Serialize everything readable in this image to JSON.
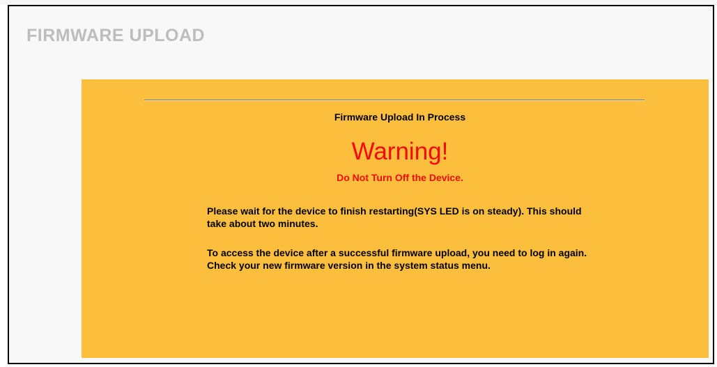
{
  "page": {
    "title": "FIRMWARE UPLOAD"
  },
  "panel": {
    "process_title": "Firmware Upload In Process",
    "warning_title": "Warning!",
    "warning_subtitle": "Do Not Turn Off the Device.",
    "message_restart": "Please wait for the device to finish restarting(SYS LED is on steady). This should take about two minutes.",
    "message_login": "To access the device after a successful firmware upload, you need to log in again. Check your new firmware version in the system status menu."
  },
  "colors": {
    "panel_background": "#fcbe3d",
    "warning_text": "#f50a0a",
    "title_text": "#bdbdbd"
  }
}
